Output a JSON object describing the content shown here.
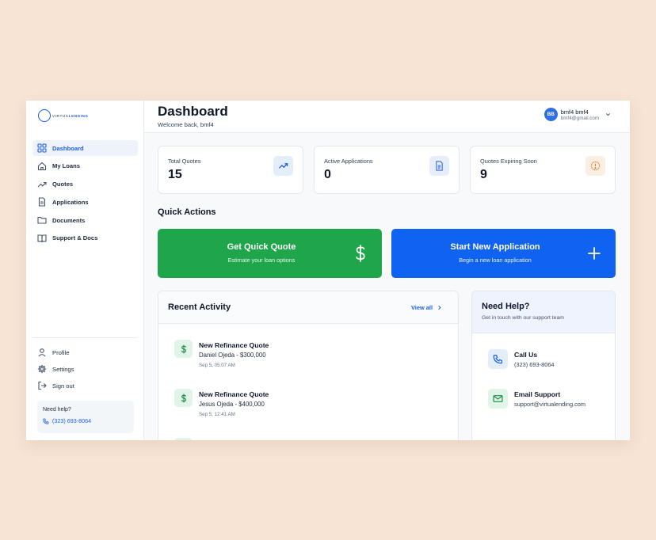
{
  "brand": {
    "name_part1": "VIRTUA",
    "name_part2": "LENDING",
    "accent": "#1d5fe0"
  },
  "sidebar": {
    "items": [
      {
        "label": "Dashboard",
        "icon": "grid-icon",
        "active": true
      },
      {
        "label": "My Loans",
        "icon": "home-icon"
      },
      {
        "label": "Quotes",
        "icon": "trending-up-icon"
      },
      {
        "label": "Applications",
        "icon": "file-icon"
      },
      {
        "label": "Documents",
        "icon": "folder-icon"
      },
      {
        "label": "Support & Docs",
        "icon": "book-icon"
      }
    ],
    "bottom": [
      {
        "label": "Profile",
        "icon": "user-icon"
      },
      {
        "label": "Settings",
        "icon": "gear-icon"
      },
      {
        "label": "Sign out",
        "icon": "logout-icon"
      }
    ],
    "help": {
      "title": "Need help?",
      "phone": "(323) 693-8064"
    }
  },
  "header": {
    "title": "Dashboard",
    "welcome": "Welcome back, bmf4",
    "user": {
      "initials": "BB",
      "name": "bmf4 bmf4",
      "email": "bmf4@gmail.com"
    }
  },
  "stats": [
    {
      "label": "Total Quotes",
      "value": "15",
      "icon": "trending-up-icon",
      "color": "#1d5fe0"
    },
    {
      "label": "Active Applications",
      "value": "0",
      "icon": "document-icon",
      "color": "#3b6fd8"
    },
    {
      "label": "Quotes Expiring Soon",
      "value": "9",
      "icon": "alert-circle-icon",
      "color": "#d9772b"
    }
  ],
  "quick_actions": {
    "title": "Quick Actions",
    "items": [
      {
        "title": "Get Quick Quote",
        "subtitle": "Estimate your loan options",
        "icon": "dollar-icon",
        "color": "#1fa64a"
      },
      {
        "title": "Start New Application",
        "subtitle": "Begin a new loan application",
        "icon": "plus-icon",
        "color": "#1062f0"
      }
    ]
  },
  "recent_activity": {
    "title": "Recent Activity",
    "view_all": "View all",
    "items": [
      {
        "title": "New Refinance Quote",
        "detail": "Daniel Ojeda - $300,000",
        "time": "Sep 5, 05:07 AM"
      },
      {
        "title": "New Refinance Quote",
        "detail": "Jesus Ojeda - $400,000",
        "time": "Sep 5, 12:41 AM"
      }
    ]
  },
  "need_help": {
    "title": "Need Help?",
    "subtitle": "Get in touch with our support team",
    "contacts": [
      {
        "title": "Call Us",
        "value": "(323) 693-8064",
        "icon": "phone-icon"
      },
      {
        "title": "Email Support",
        "value": "support@virtualending.com",
        "icon": "mail-icon"
      }
    ]
  }
}
